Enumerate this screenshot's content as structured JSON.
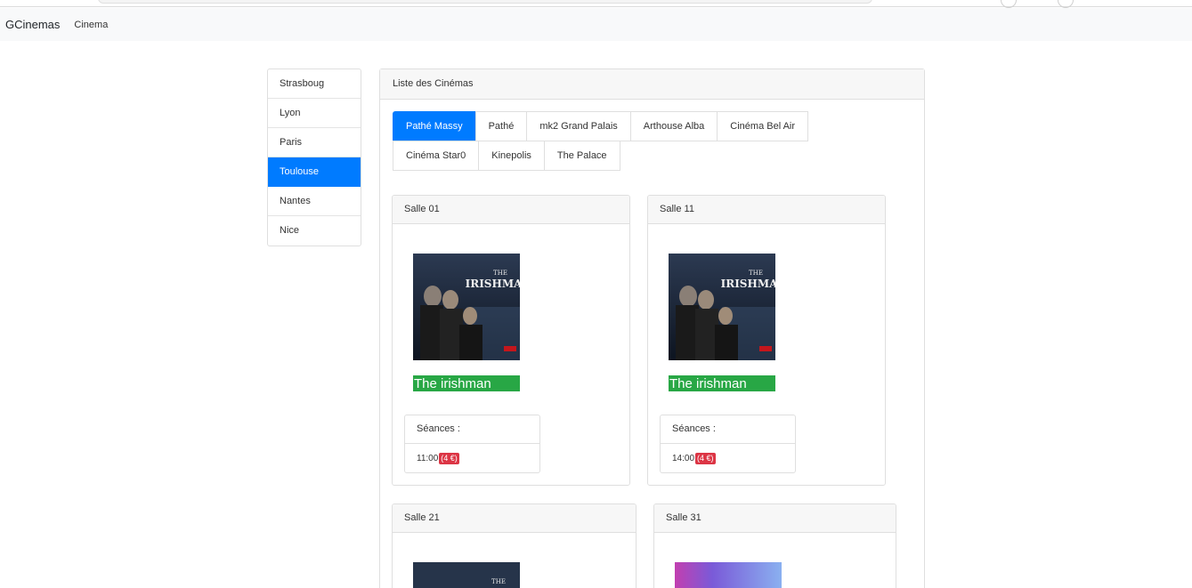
{
  "navbar": {
    "brand": "GCinemas",
    "link": "Cinema"
  },
  "cities": [
    {
      "label": "Strasboug",
      "active": false
    },
    {
      "label": "Lyon",
      "active": false
    },
    {
      "label": "Paris",
      "active": false
    },
    {
      "label": "Toulouse",
      "active": true
    },
    {
      "label": "Nantes",
      "active": false
    },
    {
      "label": "Nice",
      "active": false
    }
  ],
  "cinemas": {
    "header": "Liste des Cinémas",
    "tabs": [
      {
        "label": "Pathé Massy",
        "active": true
      },
      {
        "label": "Pathé",
        "active": false
      },
      {
        "label": "mk2 Grand Palais",
        "active": false
      },
      {
        "label": "Arthouse Alba",
        "active": false
      },
      {
        "label": "Cinéma Bel Air",
        "active": false
      },
      {
        "label": "Cinéma Star0",
        "active": false
      },
      {
        "label": "Kinepolis",
        "active": false
      },
      {
        "label": "The Palace",
        "active": false
      }
    ]
  },
  "salles": [
    {
      "name": "Salle 01",
      "film": "The irishman",
      "poster": "irishman-poster",
      "seances_label": "Séances :",
      "time": "11:00",
      "price": "(4 €)"
    },
    {
      "name": "Salle 11",
      "film": "The irishman",
      "poster": "irishman-poster",
      "seances_label": "Séances :",
      "time": "14:00",
      "price": "(4 €)"
    },
    {
      "name": "Salle 21",
      "poster": "irishman-poster"
    },
    {
      "name": "Salle 31",
      "poster": "purple-poster"
    }
  ],
  "colors": {
    "primary": "#007bff",
    "success": "#28a745",
    "danger": "#dc3545"
  }
}
